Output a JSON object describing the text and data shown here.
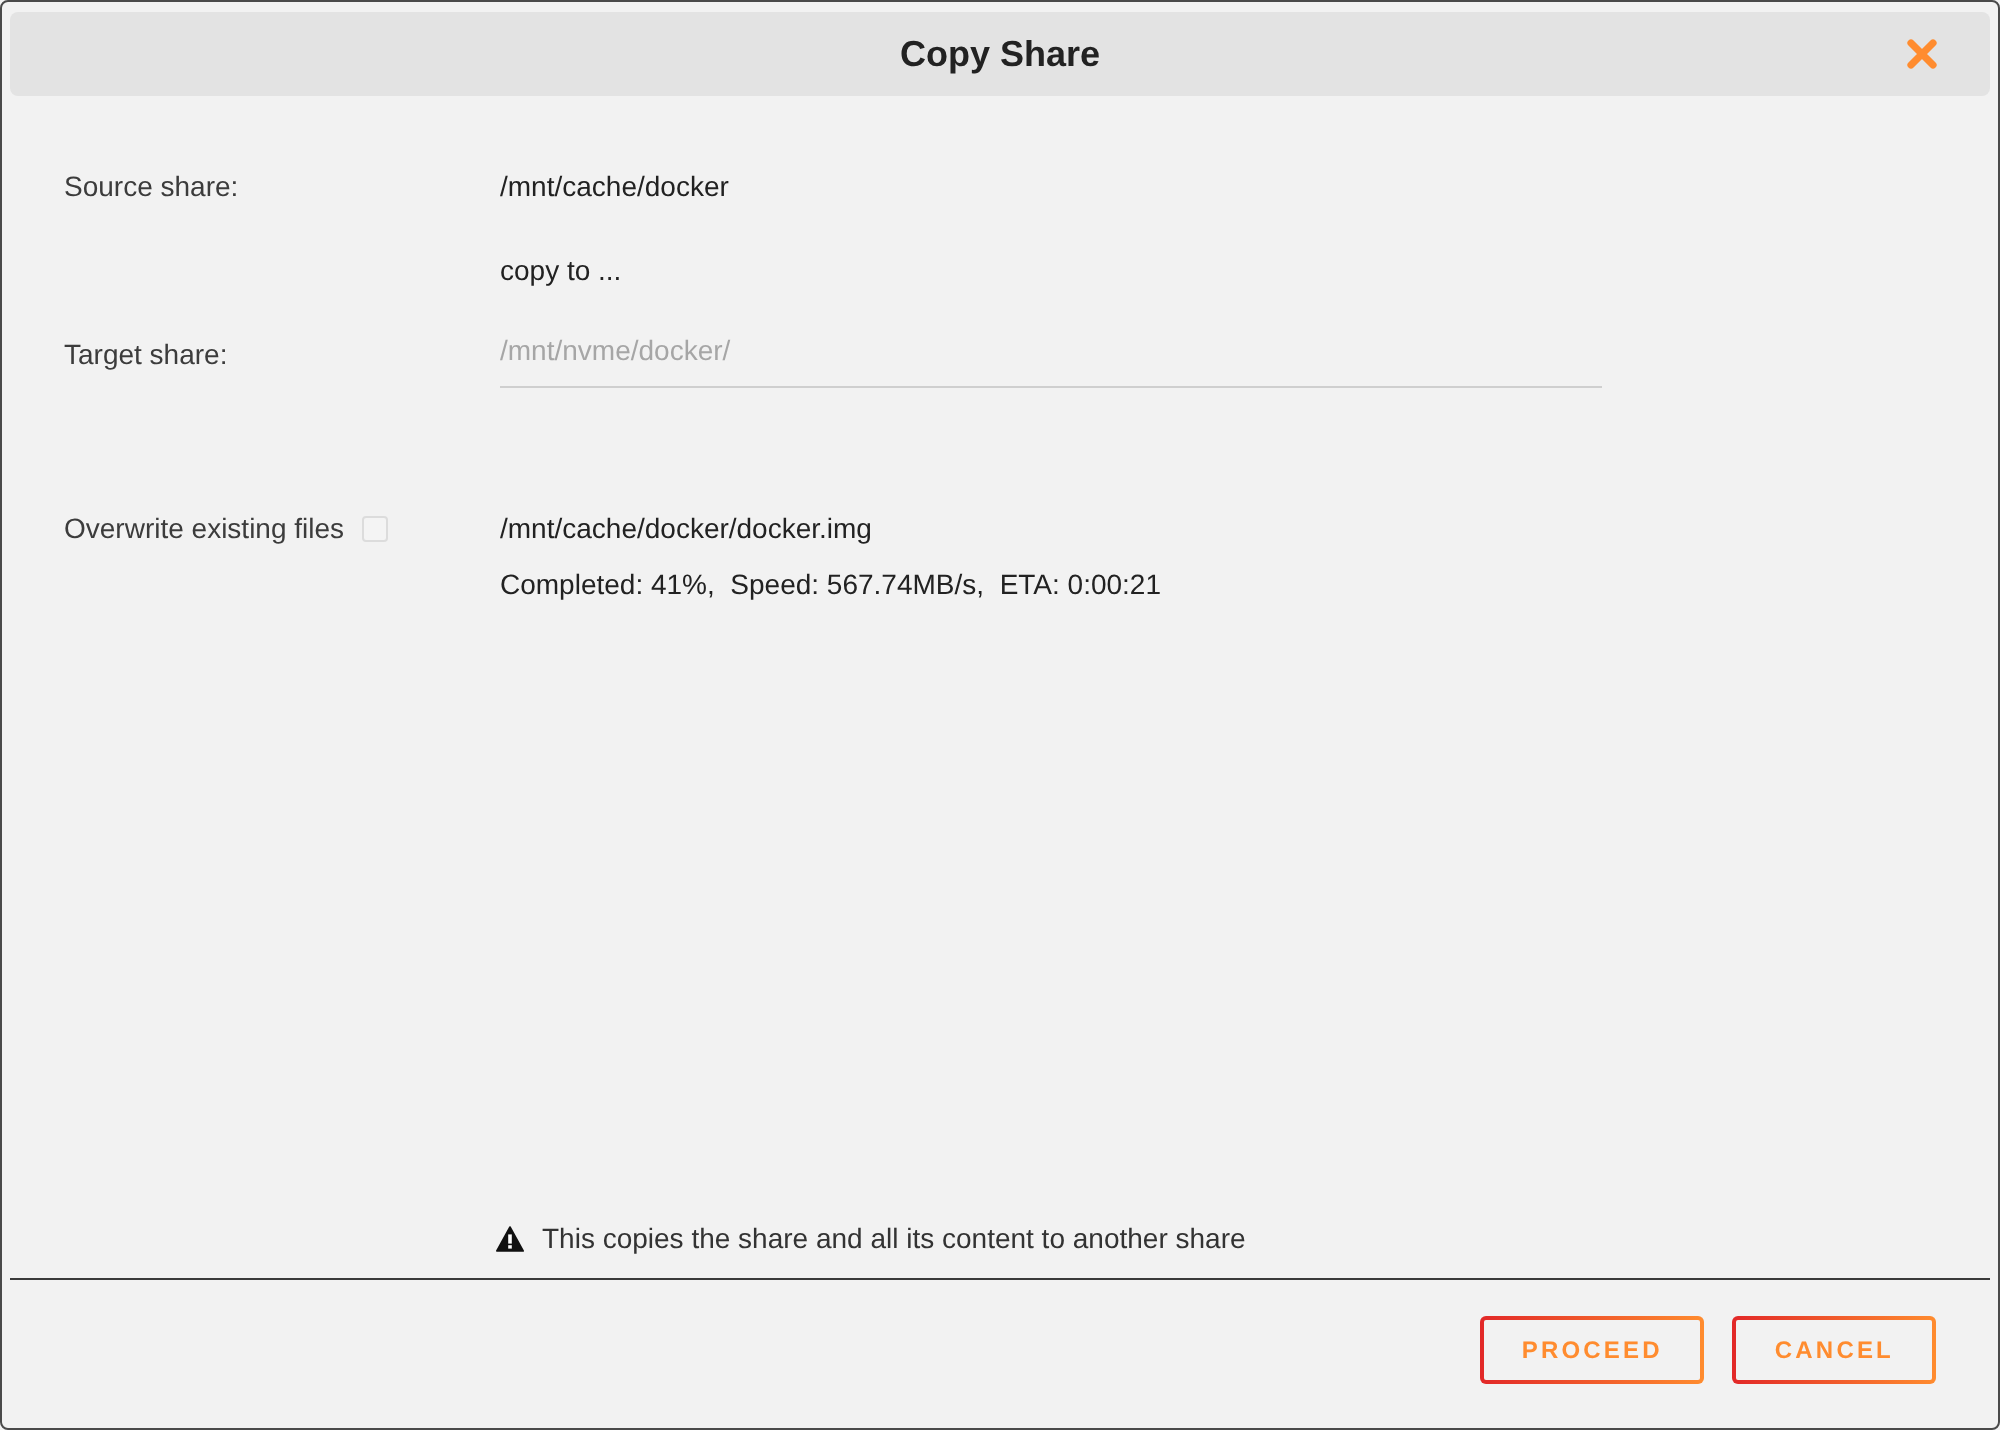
{
  "dialog": {
    "title": "Copy Share"
  },
  "fields": [
    {
      "kind": "text",
      "label": "Source share:",
      "value": "/mnt/cache/docker"
    },
    {
      "kind": "note",
      "value": "copy to ..."
    },
    {
      "kind": "input",
      "label": "Target share:",
      "placeholder": "/mnt/nvme/docker/"
    },
    {
      "kind": "checkbox",
      "label": "Overwrite existing files",
      "checked": false,
      "details": [
        "/mnt/cache/docker/docker.img",
        "Completed: 41%,  Speed: 567.74MB/s,  ETA: 0:00:21"
      ]
    }
  ],
  "warning": "This copies the share and all its content to another share",
  "buttons": [
    {
      "label": "PROCEED"
    },
    {
      "label": "CANCEL"
    }
  ]
}
